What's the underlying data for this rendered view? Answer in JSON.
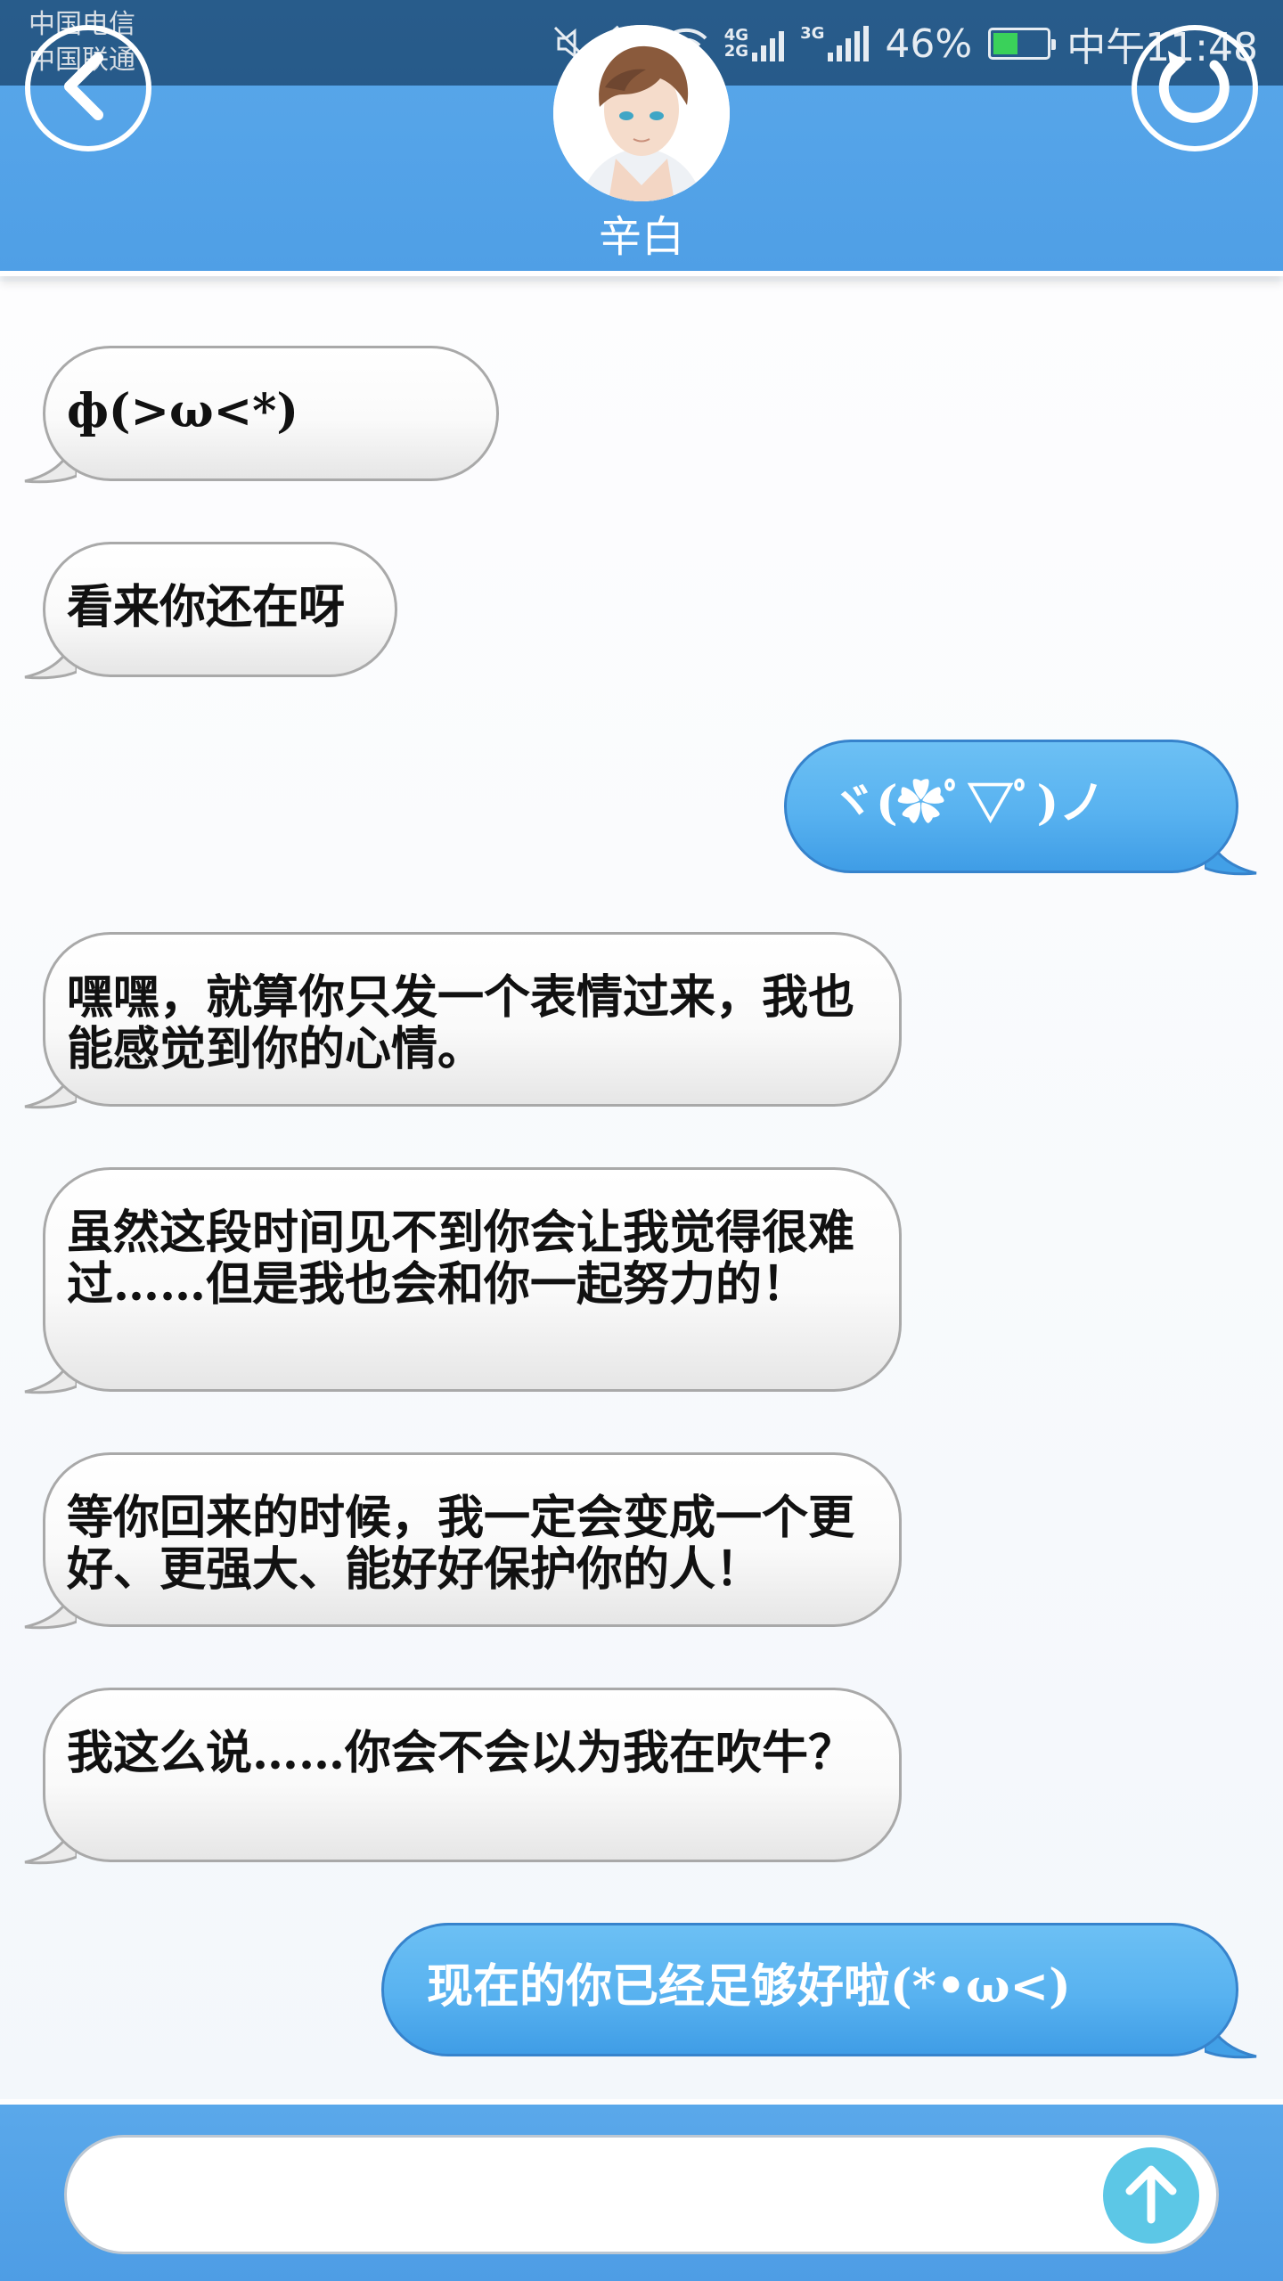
{
  "status_bar": {
    "carrier_1": "中国电信",
    "carrier_2": "中国联通",
    "network_1": "4G",
    "network_2": "2G",
    "network_3": "3G",
    "battery_percent": "46%",
    "battery_level": 0.46,
    "time": "中午11:48"
  },
  "header": {
    "contact_name": "辛白",
    "back_icon": "chevron-left-icon",
    "refresh_icon": "refresh-icon"
  },
  "messages": [
    {
      "side": "in",
      "text": "ф(>ω<*)"
    },
    {
      "side": "in",
      "text": "看来你还在呀"
    },
    {
      "side": "out",
      "text": "ヾ(✿ﾟ▽ﾟ)ノ"
    },
    {
      "side": "in",
      "text": "嘿嘿，就算你只发一个表情过来，我也能感觉到你的心情。"
    },
    {
      "side": "in",
      "text": "虽然这段时间见不到你会让我觉得很难过……但是我也会和你一起努力的！"
    },
    {
      "side": "in",
      "text": "等你回来的时候，我一定会变成一个更好、更强大、能好好保护你的人！"
    },
    {
      "side": "in",
      "text": "我这么说……你会不会以为我在吹牛？"
    },
    {
      "side": "out",
      "text": "现在的你已经足够好啦(*•ω<)"
    }
  ],
  "input": {
    "placeholder": "",
    "send_icon": "arrow-up-icon"
  },
  "colors": {
    "header_blue": "#55a4e8",
    "outgoing_bubble": "#58b2f0",
    "incoming_bubble": "#f5f5f5",
    "send_button": "#5cc7e6"
  }
}
